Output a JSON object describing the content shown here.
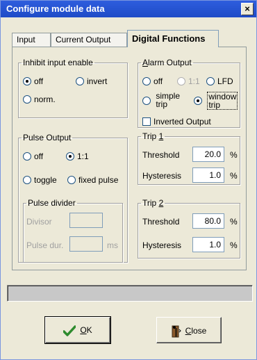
{
  "window": {
    "title": "Configure module data",
    "close": "×"
  },
  "tabs": [
    {
      "label": "Input"
    },
    {
      "label": "Current Output"
    },
    {
      "label": "Digital Functions"
    }
  ],
  "inhibit": {
    "legend": "Inhibit input enable",
    "off": "off",
    "invert": "invert",
    "norm": "norm.",
    "selected": "off"
  },
  "alarm": {
    "legend_hotkey": "A",
    "legend_rest": "larm Output",
    "off": "off",
    "one_to_one": "1:1",
    "lfd": "LFD",
    "simple_trip_1": "simple",
    "simple_trip_2": "trip",
    "window_trip_1": "window",
    "window_trip_2": "trip",
    "inverted": "Inverted Output",
    "selected": "window trip"
  },
  "pulse": {
    "legend": "Pulse Output",
    "off": "off",
    "one_to_one": "1:1",
    "toggle": "toggle",
    "fixed": "fixed pulse",
    "selected": "1:1"
  },
  "divider": {
    "legend": "Pulse divider",
    "divisor": "Divisor",
    "divisor_value": "",
    "duration": "Pulse dur.",
    "duration_value": "",
    "unit": "ms"
  },
  "trip1": {
    "legend_text": "Trip ",
    "legend_hotkey": "1",
    "threshold_label": "Threshold",
    "threshold_value": "20.0",
    "threshold_unit": "%",
    "hysteresis_label": "Hysteresis",
    "hysteresis_value": "1.0",
    "hysteresis_unit": "%"
  },
  "trip2": {
    "legend_text": "Trip ",
    "legend_hotkey": "2",
    "threshold_label": "Threshold",
    "threshold_value": "80.0",
    "threshold_unit": "%",
    "hysteresis_label": "Hysteresis",
    "hysteresis_value": "1.0",
    "hysteresis_unit": "%"
  },
  "buttons": {
    "ok_hotkey": "O",
    "ok_rest": "K",
    "close_hotkey": "C",
    "close_rest": "lose"
  },
  "colors": {
    "titlebar": "#2E5DDD",
    "ok_check": "#2E8B2E",
    "close_door": "#8B5A2B"
  },
  "icons": {
    "ok": "checkmark-icon",
    "close": "door-exit-icon"
  }
}
